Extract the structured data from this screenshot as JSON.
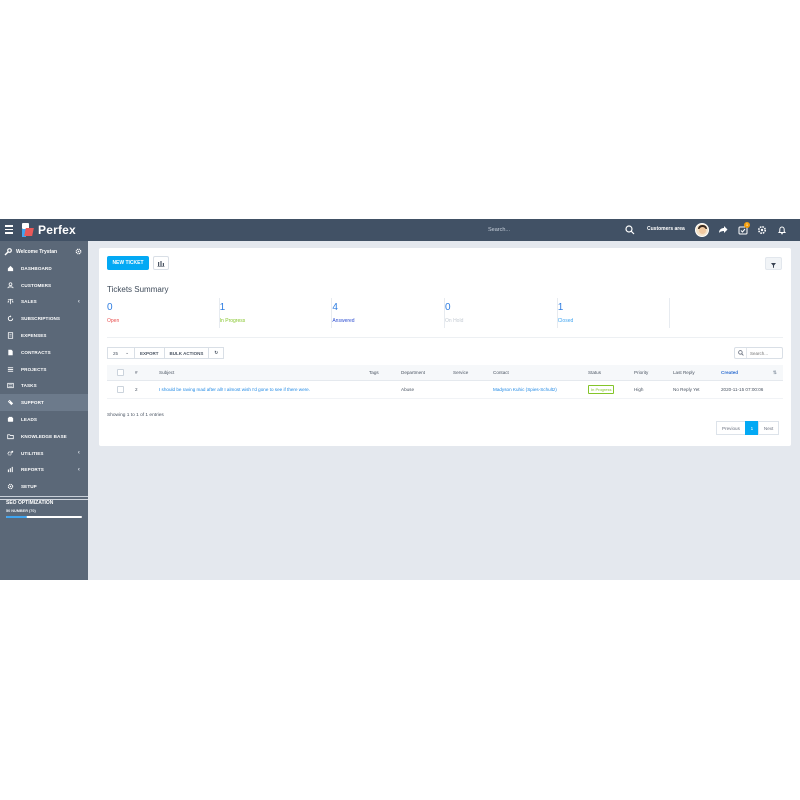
{
  "app": {
    "brand": "Perfex"
  },
  "topbar": {
    "search_placeholder": "Search...",
    "customers_area": "Customers area",
    "todo_badge": "1",
    "icons": [
      "hamburger-icon",
      "search-icon",
      "share-icon",
      "todo-icon",
      "gear-icon",
      "bell-icon"
    ]
  },
  "sidebar": {
    "welcome": "Welcome Trystan",
    "items": [
      {
        "label": "DASHBOARD",
        "icon": "home-icon"
      },
      {
        "label": "CUSTOMERS",
        "icon": "user-icon"
      },
      {
        "label": "SALES",
        "icon": "balance-icon",
        "chevron": "‹"
      },
      {
        "label": "SUBSCRIPTIONS",
        "icon": "refresh-icon"
      },
      {
        "label": "EXPENSES",
        "icon": "file-icon"
      },
      {
        "label": "CONTRACTS",
        "icon": "document-icon"
      },
      {
        "label": "PROJECTS",
        "icon": "bars-icon"
      },
      {
        "label": "TASKS",
        "icon": "tasks-icon"
      },
      {
        "label": "SUPPORT",
        "icon": "ticket-icon",
        "active": true
      },
      {
        "label": "LEADS",
        "icon": "tty-icon"
      },
      {
        "label": "KNOWLEDGE BASE",
        "icon": "folder-icon"
      },
      {
        "label": "UTILITIES",
        "icon": "cogs-icon",
        "chevron": "‹"
      },
      {
        "label": "REPORTS",
        "icon": "chart-icon",
        "chevron": "‹"
      },
      {
        "label": "SETUP",
        "icon": "settings-icon"
      }
    ],
    "seo": {
      "title": "SEO OPTIMIZATION",
      "sub": "50 NUMBER (70)",
      "progress": 0.28
    }
  },
  "panel": {
    "new_ticket": "NEW TICKET",
    "summary_title": "Tickets Summary",
    "stats": [
      {
        "num": "0",
        "label": "Open",
        "color": "#e94f4f"
      },
      {
        "num": "1",
        "label": "In Progress",
        "color": "#84c529"
      },
      {
        "num": "4",
        "label": "Answered",
        "color": "#2f4fd1"
      },
      {
        "num": "0",
        "label": "On Hold",
        "color": "#c4cbd3"
      },
      {
        "num": "1",
        "label": "Closed",
        "color": "#3fa4f0"
      },
      {
        "num": "",
        "label": "",
        "color": "#ffffff"
      }
    ],
    "page_size": "25",
    "export": "EXPORT",
    "bulk_actions": "BULK ACTIONS",
    "table_search_placeholder": "Search...",
    "columns": [
      "",
      "#",
      "Subject",
      "Tags",
      "Department",
      "Service",
      "Contact",
      "Status",
      "Priority",
      "Last Reply",
      "Created"
    ],
    "rows": [
      {
        "id": "2",
        "subject": "I should be raving mad after all! I almost wish I'd gone to see if there were.",
        "tags": "",
        "department": "Abuse",
        "service": "",
        "contact": "Madyson Kuhic (Spies-Schultz)",
        "status": "In Progress",
        "priority": "High",
        "last_reply": "No Reply Yet",
        "created": "2020-11-15 07:00:06"
      }
    ],
    "showing": "Showing 1 to 1 of 1 entries",
    "pager": {
      "previous": "Previous",
      "current": "1",
      "next": "Next"
    }
  }
}
